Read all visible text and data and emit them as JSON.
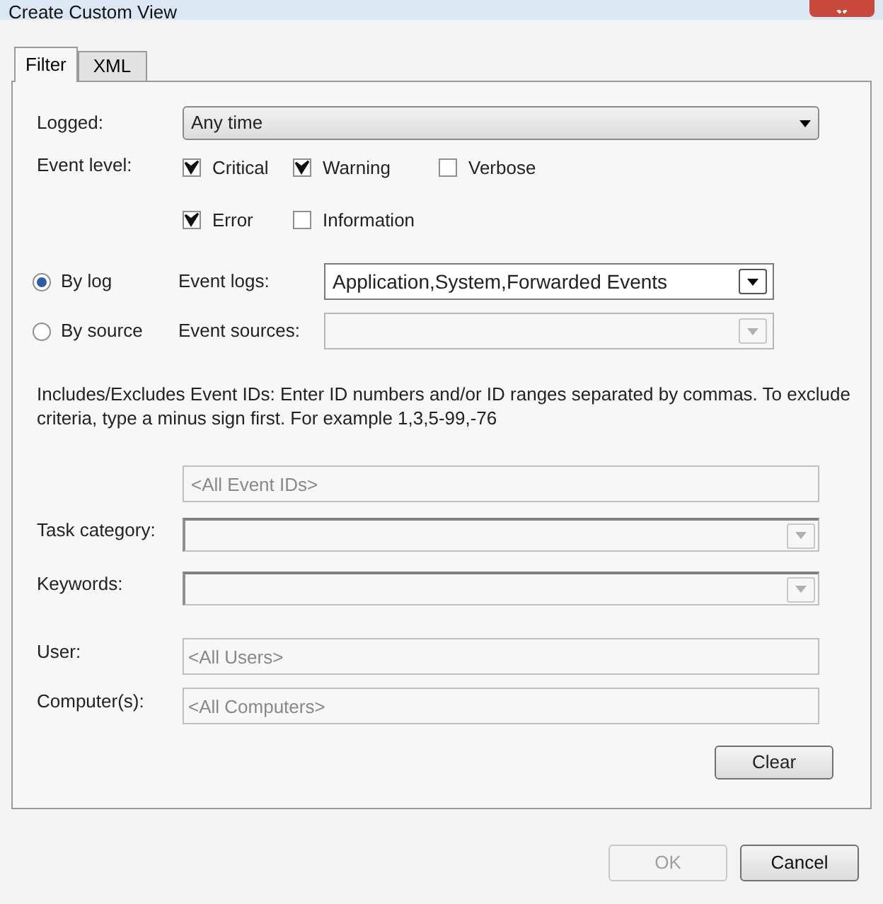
{
  "window": {
    "title": "Create Custom View"
  },
  "tabs": [
    {
      "label": "Filter",
      "selected": true
    },
    {
      "label": "XML",
      "selected": false
    }
  ],
  "logged": {
    "label": "Logged:",
    "value": "Any time"
  },
  "event_level": {
    "label": "Event level:",
    "options": [
      {
        "label": "Critical",
        "checked": true
      },
      {
        "label": "Warning",
        "checked": true
      },
      {
        "label": "Verbose",
        "checked": false
      },
      {
        "label": "Error",
        "checked": true
      },
      {
        "label": "Information",
        "checked": false
      }
    ]
  },
  "sources": [
    {
      "radio": "By log",
      "selected": true,
      "label": "Event logs:",
      "value": "Application,System,Forwarded Events"
    },
    {
      "radio": "By source",
      "selected": false,
      "label": "Event sources:"
    }
  ],
  "event_ids": {
    "description": "Includes/Excludes Event IDs: Enter ID numbers and/or ID ranges separated by commas. To exclude criteria, type a minus sign first. For example 1,3,5-99,-76",
    "placeholder": "<All Event IDs>"
  },
  "fields": [
    {
      "kind": "dropdown",
      "label": "Task category:"
    },
    {
      "kind": "dropdown",
      "label": "Keywords:"
    },
    {
      "kind": "text",
      "label": "User:",
      "placeholder": "<All Users>"
    },
    {
      "kind": "text",
      "label": "Computer(s):",
      "placeholder": "<All Computers>"
    }
  ],
  "clear_button": "Clear",
  "buttons": [
    {
      "label": "OK",
      "disabled": true
    },
    {
      "label": "Cancel",
      "disabled": false
    }
  ]
}
